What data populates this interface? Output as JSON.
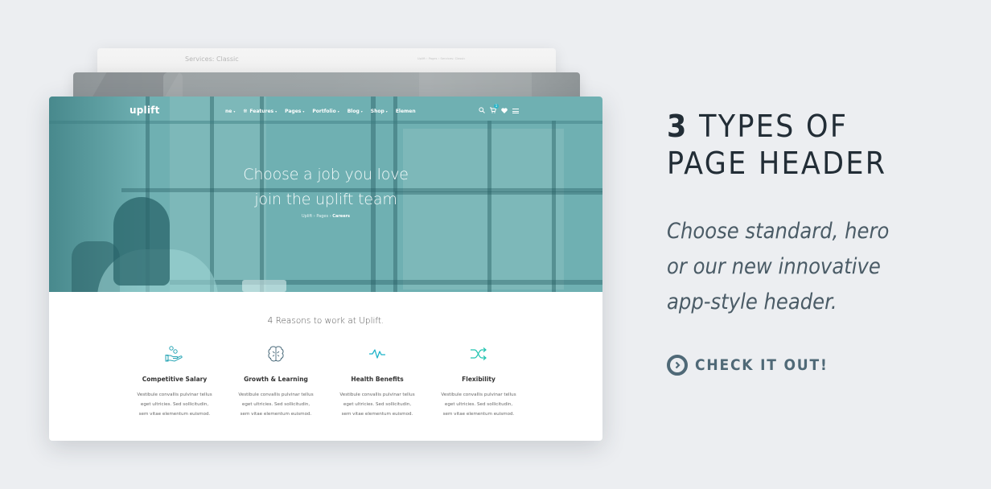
{
  "mockups": {
    "back": {
      "title": "Services: Classic",
      "breadcrumb": [
        "Uplift",
        "Pages",
        "Services: Classic"
      ]
    },
    "front": {
      "logo": "uplift",
      "nav": {
        "items": [
          {
            "label": "ne",
            "caret": "▾"
          },
          {
            "label": "Features",
            "caret": "▾",
            "icon": "features-icon"
          },
          {
            "label": "Pages",
            "caret": "▾"
          },
          {
            "label": "Portfolio",
            "caret": "▾"
          },
          {
            "label": "Blog",
            "caret": "▾"
          },
          {
            "label": "Shop",
            "caret": "▾"
          },
          {
            "label": "Elemen",
            "caret": ""
          }
        ],
        "cart_count": "1",
        "icons": [
          "search-icon",
          "cart-icon",
          "heart-icon",
          "menu-icon"
        ]
      },
      "hero": {
        "title_line1": "Choose a job you love",
        "title_line2": "join the uplift team",
        "breadcrumb": {
          "items": [
            "Uplift",
            "Pages"
          ],
          "current": "Careers",
          "separator": "›"
        }
      },
      "section_title": "4 Reasons to work at Uplift.",
      "features": [
        {
          "icon": "hand-coins-icon",
          "title": "Competitive Salary",
          "desc_lines": [
            "Vestibule convallis pulvinar tellus",
            "eget ultricies. Sed sollicitudin,",
            "sem vitae elementum euismod."
          ]
        },
        {
          "icon": "brain-icon",
          "title": "Growth & Learning",
          "desc_lines": [
            "Vestibule convallis pulvinar tellus",
            "eget ultricies. Sed sollicitudin,",
            "sem vitae elementum euismod."
          ]
        },
        {
          "icon": "pulse-icon",
          "title": "Health Benefits",
          "desc_lines": [
            "Vestibule convallis pulvinar tellus",
            "eget ultricies. Sed sollicitudin,",
            "sem vitae elementum euismod."
          ]
        },
        {
          "icon": "shuffle-icon",
          "title": "Flexibility",
          "desc_lines": [
            "Vestibule convallis pulvinar tellus",
            "eget ultricies. Sed sollicitudin,",
            "sem vitae elementum euismod."
          ]
        }
      ]
    }
  },
  "promo": {
    "headline_number": "3",
    "headline_rest_line1": "TYPES OF",
    "headline_line2": "PAGE HEADER",
    "subtext_line1": "Choose standard, hero",
    "subtext_line2": "or our new innovative",
    "subtext_line3": "app-style header.",
    "cta_label": "CHECK IT OUT!"
  },
  "colors": {
    "background": "#eceef1",
    "hero_teal": "#6fb0b2",
    "accent": "#2bb6c9",
    "headline": "#222d36",
    "subtext": "#4a5b66",
    "cta": "#4f6977"
  }
}
